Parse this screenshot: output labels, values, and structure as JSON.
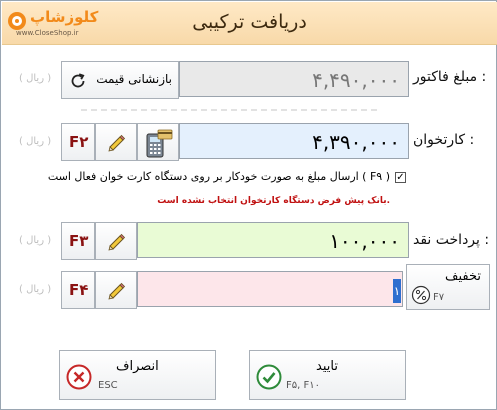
{
  "header": {
    "title": "دریافت ترکیبی",
    "logo_text": "کلوزشاپ",
    "logo_site": "www.CloseShop.ir"
  },
  "invoice": {
    "label": "مبلغ فاکتور :",
    "value": "۴,۴۹۰,۰۰۰",
    "unit": "( ریال )",
    "reset_label": "بازنشانی قیمت"
  },
  "card": {
    "label": "کارتخوان :",
    "value": "۴,۳۹۰,۰۰۰",
    "unit": "( ریال )",
    "key": "F۲",
    "checkbox_checked": true,
    "checkbox_label": "ارسال مبلغ به صورت خودکار بر روی دستگاه کارت خوان فعال است ( F۹ )",
    "warning": "بانک پیش فرض دستگاه کارتخوان انتخاب نشده است."
  },
  "cash": {
    "label": "پرداخت نقد :",
    "value": "۱۰۰,۰۰۰",
    "unit": "( ریال )",
    "key": "F۳"
  },
  "other": {
    "value": "۱",
    "unit": "( ریال )",
    "key": "F۴"
  },
  "discount": {
    "label": "تخفیف",
    "key": "F۷"
  },
  "cancel": {
    "label": "انصراف",
    "key": "ESC"
  },
  "confirm": {
    "label": "تایید",
    "key": "F۵, F۱۰"
  },
  "colors": {
    "header_bg": "#f8d9a9",
    "card_field_bg": "#e4f0fd",
    "cash_field_bg": "#e9fbd5",
    "other_field_bg": "#fde6ea",
    "key_color": "#8a1212",
    "warning_color": "#c01010"
  }
}
